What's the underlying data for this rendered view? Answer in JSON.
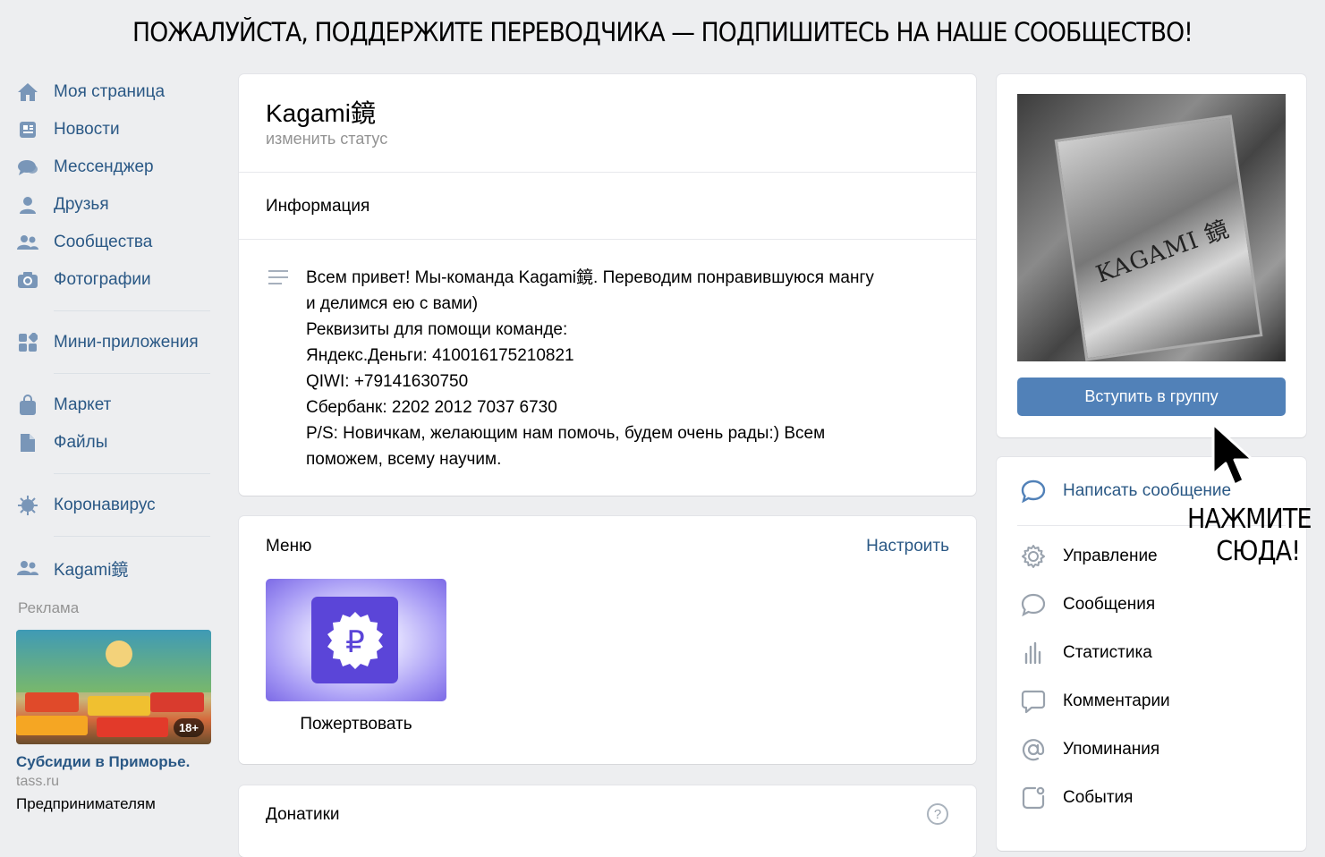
{
  "banner": "ПОЖАЛУЙСТА, ПОДДЕРЖИТЕ ПЕРЕВОДЧИКА — ПОДПИШИТЕСЬ НА НАШЕ СООБЩЕСТВО!",
  "nav": {
    "my_page": "Моя страница",
    "news": "Новости",
    "messenger": "Мессенджер",
    "friends": "Друзья",
    "communities": "Сообщества",
    "photos": "Фотографии",
    "mini_apps": "Мини-приложения",
    "market": "Маркет",
    "files": "Файлы",
    "coronavirus": "Коронавирус",
    "group": "Kagami鏡"
  },
  "ads": {
    "title": "Реклама",
    "badge": "18+",
    "link": "Субсидии в Приморье.",
    "domain": "tass.ru",
    "text": "Предпринимателям"
  },
  "group": {
    "name": "Kagami鏡",
    "status": "изменить статус",
    "info_title": "Информация",
    "description": [
      "Всем привет! Мы-команда Kagami鏡. Переводим понравившуюся мангу",
      "и делимся ею с вами)",
      "Реквизиты для помощи команде:",
      "Яндекс.Деньги: 410016175210821",
      "QIWI: +79141630750",
      "Сбербанк: 2202 2012 7037 6730",
      "P/S: Новичкам, желающим нам помочь, будем очень рады:) Всем",
      "поможем, всему научим."
    ]
  },
  "menu": {
    "title": "Меню",
    "configure": "Настроить",
    "donate_symbol": "₽",
    "donate_label": "Пожертвовать"
  },
  "donators": {
    "title": "Донатики",
    "help": "?"
  },
  "cover": {
    "text": "KAGAMI 鏡"
  },
  "sidebar": {
    "join": "Вступить в группу",
    "write": "Написать сообщение",
    "manage": "Управление",
    "messages": "Сообщения",
    "stats": "Статистика",
    "comments": "Комментарии",
    "mentions": "Упоминания",
    "events": "События"
  },
  "annotation": {
    "line1": "НАЖМИТЕ",
    "line2": "СЮДА!"
  },
  "colors": {
    "link": "#2a5885",
    "button": "#5181b8",
    "bg": "#edeef0",
    "icon": "#99a2ad"
  }
}
